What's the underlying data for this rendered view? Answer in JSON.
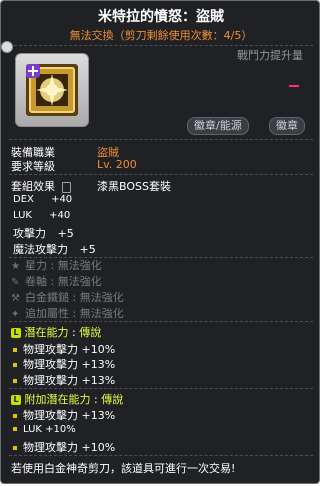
{
  "item": {
    "title": "米特拉的憤怒：盜賊",
    "trade_note": "無法交換（剪刀剩餘使用次數：4/5）",
    "combat_power_label": "戰鬥力提升量",
    "badges": [
      "徽章/能源",
      "徽章"
    ]
  },
  "requirements": {
    "job_label": "裝備職業",
    "job_value": "盜賊",
    "level_label": "要求等級",
    "level_value": "Lv. 200"
  },
  "set": {
    "label": "套組效果",
    "value": "漆黑BOSS套裝"
  },
  "stats": [
    {
      "name": "DEX",
      "value": "+40"
    },
    {
      "name": "LUK",
      "value": "+40"
    },
    {
      "name": "攻擊力",
      "value": "+5"
    },
    {
      "name": "魔法攻擊力",
      "value": "+5"
    }
  ],
  "disabled": [
    {
      "icon": "star-icon",
      "label": "星力",
      "value": "無法強化"
    },
    {
      "icon": "scroll-icon",
      "label": "卷軸",
      "value": "無法強化"
    },
    {
      "icon": "hammer-icon",
      "label": "白金鐵鎚",
      "value": "無法強化"
    },
    {
      "icon": "flame-icon",
      "label": "追加屬性",
      "value": "無法強化"
    }
  ],
  "potential": {
    "grade_letter": "L",
    "title": "潛在能力",
    "grade": "傳說",
    "lines": [
      "物理攻擊力 +10%",
      "物理攻擊力 +13%",
      "物理攻擊力 +13%"
    ]
  },
  "bonus_potential": {
    "grade_letter": "L",
    "title": "附加潛在能力",
    "grade": "傳說",
    "lines": [
      "物理攻擊力 +13%",
      "LUK +10%",
      "物理攻擊力 +10%"
    ]
  },
  "footer": "若使用白金神奇剪刀，該道具可進行一次交易!",
  "colors": {
    "accent": "#f08d32",
    "legendary": "#e6ff3b",
    "background": "#1f2124"
  }
}
